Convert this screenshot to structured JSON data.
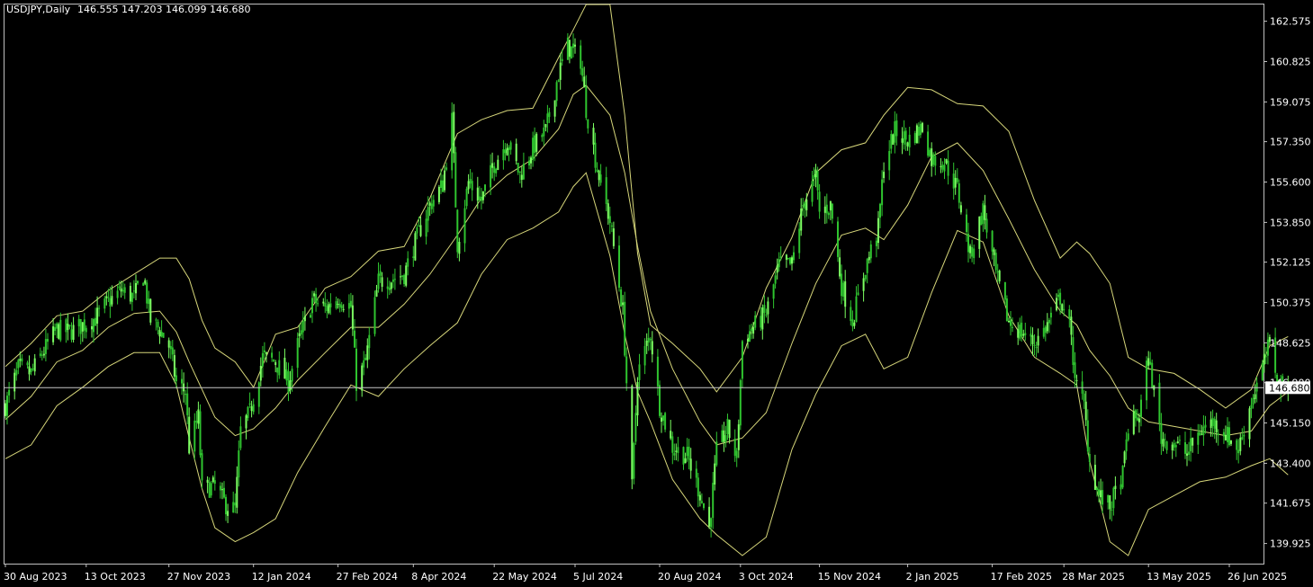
{
  "header": {
    "symbol_label": "USDJPY,Daily",
    "ohlc_text": "146.555 147.203 146.099 146.680"
  },
  "colors": {
    "background": "#000000",
    "frame": "#c0c0c0",
    "candle": "#2fc42f",
    "candle_bright": "#7cff62",
    "bands": "#d6d67a",
    "axis_text": "#ffffff",
    "current_price_line": "#c8c8c8"
  },
  "chart_data": {
    "type": "candlestick",
    "symbol": "USDJPY",
    "timeframe": "Daily",
    "last_ohlc": {
      "open": 146.555,
      "high": 147.203,
      "low": 146.099,
      "close": 146.68
    },
    "current_price": 146.68,
    "current_price_label": "146.680",
    "ylim": [
      139.05,
      163.3
    ],
    "y_ticks": [
      "162.575",
      "160.825",
      "159.075",
      "157.350",
      "155.600",
      "153.850",
      "152.125",
      "150.375",
      "148.625",
      "146.900",
      "145.150",
      "143.400",
      "141.675",
      "139.925"
    ],
    "x_ticks": [
      "30 Aug 2023",
      "13 Oct 2023",
      "27 Nov 2023",
      "12 Jan 2024",
      "27 Feb 2024",
      "8 Apr 2024",
      "22 May 2024",
      "5 Jul 2024",
      "20 Aug 2024",
      "3 Oct 2024",
      "15 Nov 2024",
      "2 Jan 2025",
      "17 Feb 2025",
      "28 Mar 2025",
      "13 May 2025",
      "26 Jun 2025"
    ],
    "indicator": "Bollinger Bands",
    "price_path": [
      [
        "2023-08-30",
        145.9
      ],
      [
        "2023-09-06",
        147.5
      ],
      [
        "2023-09-13",
        147.3
      ],
      [
        "2023-09-20",
        148.3
      ],
      [
        "2023-09-27",
        149.2
      ],
      [
        "2023-10-04",
        149.1
      ],
      [
        "2023-10-11",
        149.4
      ],
      [
        "2023-10-18",
        149.7
      ],
      [
        "2023-10-25",
        150.4
      ],
      [
        "2023-11-01",
        150.9
      ],
      [
        "2023-11-08",
        150.6
      ],
      [
        "2023-11-13",
        151.6
      ],
      [
        "2023-11-17",
        149.6
      ],
      [
        "2023-11-22",
        149.2
      ],
      [
        "2023-11-27",
        148.5
      ],
      [
        "2023-12-01",
        146.9
      ],
      [
        "2023-12-06",
        146.5
      ],
      [
        "2023-12-08",
        144.1
      ],
      [
        "2023-12-13",
        145.4
      ],
      [
        "2023-12-15",
        142.3
      ],
      [
        "2023-12-22",
        142.4
      ],
      [
        "2023-12-28",
        141.6
      ],
      [
        "2024-01-02",
        141.4
      ],
      [
        "2024-01-05",
        144.8
      ],
      [
        "2024-01-10",
        145.6
      ],
      [
        "2024-01-17",
        148.0
      ],
      [
        "2024-01-24",
        147.8
      ],
      [
        "2024-01-31",
        146.9
      ],
      [
        "2024-02-05",
        148.5
      ],
      [
        "2024-02-13",
        150.5
      ],
      [
        "2024-02-20",
        150.1
      ],
      [
        "2024-02-27",
        150.6
      ],
      [
        "2024-03-05",
        150.2
      ],
      [
        "2024-03-08",
        146.9
      ],
      [
        "2024-03-13",
        147.8
      ],
      [
        "2024-03-20",
        151.3
      ],
      [
        "2024-03-27",
        151.4
      ],
      [
        "2024-04-03",
        151.6
      ],
      [
        "2024-04-10",
        153.2
      ],
      [
        "2024-04-17",
        154.6
      ],
      [
        "2024-04-24",
        155.5
      ],
      [
        "2024-04-29",
        158.3
      ],
      [
        "2024-05-02",
        152.9
      ],
      [
        "2024-05-08",
        155.6
      ],
      [
        "2024-05-15",
        154.8
      ],
      [
        "2024-05-22",
        156.4
      ],
      [
        "2024-05-29",
        157.4
      ],
      [
        "2024-06-05",
        155.9
      ],
      [
        "2024-06-12",
        157.1
      ],
      [
        "2024-06-19",
        157.8
      ],
      [
        "2024-06-26",
        160.3
      ],
      [
        "2024-07-01",
        161.5
      ],
      [
        "2024-07-08",
        160.9
      ],
      [
        "2024-07-11",
        158.8
      ],
      [
        "2024-07-17",
        156.2
      ],
      [
        "2024-07-24",
        153.9
      ],
      [
        "2024-07-31",
        150.0
      ],
      [
        "2024-08-05",
        142.3
      ],
      [
        "2024-08-08",
        147.3
      ],
      [
        "2024-08-15",
        149.0
      ],
      [
        "2024-08-20",
        145.9
      ],
      [
        "2024-08-27",
        144.1
      ],
      [
        "2024-09-04",
        143.7
      ],
      [
        "2024-09-11",
        142.1
      ],
      [
        "2024-09-16",
        140.6
      ],
      [
        "2024-09-20",
        143.9
      ],
      [
        "2024-09-26",
        144.9
      ],
      [
        "2024-10-01",
        143.6
      ],
      [
        "2024-10-04",
        148.7
      ],
      [
        "2024-10-10",
        149.3
      ],
      [
        "2024-10-17",
        149.9
      ],
      [
        "2024-10-24",
        152.0
      ],
      [
        "2024-10-31",
        152.0
      ],
      [
        "2024-11-06",
        154.6
      ],
      [
        "2024-11-13",
        155.8
      ],
      [
        "2024-11-15",
        154.3
      ],
      [
        "2024-11-21",
        154.6
      ],
      [
        "2024-11-27",
        151.1
      ],
      [
        "2024-12-03",
        149.6
      ],
      [
        "2024-12-10",
        151.9
      ],
      [
        "2024-12-17",
        153.6
      ],
      [
        "2024-12-20",
        156.4
      ],
      [
        "2024-12-26",
        157.8
      ],
      [
        "2025-01-02",
        157.4
      ],
      [
        "2025-01-10",
        158.0
      ],
      [
        "2025-01-15",
        156.6
      ],
      [
        "2025-01-22",
        156.5
      ],
      [
        "2025-01-29",
        155.3
      ],
      [
        "2025-02-05",
        152.4
      ],
      [
        "2025-02-12",
        154.4
      ],
      [
        "2025-02-19",
        151.6
      ],
      [
        "2025-02-26",
        149.5
      ],
      [
        "2025-03-05",
        149.1
      ],
      [
        "2025-03-12",
        148.6
      ],
      [
        "2025-03-19",
        149.4
      ],
      [
        "2025-03-26",
        150.6
      ],
      [
        "2025-03-31",
        149.3
      ],
      [
        "2025-04-04",
        146.7
      ],
      [
        "2025-04-08",
        145.9
      ],
      [
        "2025-04-11",
        143.5
      ],
      [
        "2025-04-16",
        142.0
      ],
      [
        "2025-04-22",
        141.5
      ],
      [
        "2025-04-29",
        142.9
      ],
      [
        "2025-05-02",
        145.0
      ],
      [
        "2025-05-08",
        145.5
      ],
      [
        "2025-05-13",
        148.0
      ],
      [
        "2025-05-20",
        144.5
      ],
      [
        "2025-05-27",
        144.3
      ],
      [
        "2025-06-03",
        143.8
      ],
      [
        "2025-06-10",
        144.8
      ],
      [
        "2025-06-17",
        145.2
      ],
      [
        "2025-06-24",
        144.7
      ],
      [
        "2025-07-01",
        144.0
      ],
      [
        "2025-07-08",
        146.1
      ],
      [
        "2025-07-15",
        147.8
      ],
      [
        "2025-07-18",
        148.6
      ],
      [
        "2025-07-23",
        146.8
      ],
      [
        "2025-07-28",
        146.68
      ]
    ],
    "upper_band": [
      [
        "2023-08-30",
        147.6
      ],
      [
        "2023-09-13",
        148.6
      ],
      [
        "2023-09-27",
        149.8
      ],
      [
        "2023-10-11",
        150.0
      ],
      [
        "2023-10-25",
        150.9
      ],
      [
        "2023-11-08",
        151.6
      ],
      [
        "2023-11-22",
        152.3
      ],
      [
        "2023-12-01",
        152.3
      ],
      [
        "2023-12-08",
        151.4
      ],
      [
        "2023-12-15",
        149.6
      ],
      [
        "2023-12-22",
        148.4
      ],
      [
        "2024-01-02",
        147.8
      ],
      [
        "2024-01-12",
        146.7
      ],
      [
        "2024-01-24",
        149.0
      ],
      [
        "2024-02-05",
        149.3
      ],
      [
        "2024-02-20",
        151.0
      ],
      [
        "2024-03-05",
        151.5
      ],
      [
        "2024-03-20",
        152.6
      ],
      [
        "2024-04-03",
        152.8
      ],
      [
        "2024-04-17",
        154.9
      ],
      [
        "2024-05-02",
        157.7
      ],
      [
        "2024-05-15",
        158.3
      ],
      [
        "2024-05-29",
        158.7
      ],
      [
        "2024-06-12",
        158.8
      ],
      [
        "2024-06-26",
        161.0
      ],
      [
        "2024-07-04",
        162.2
      ],
      [
        "2024-07-11",
        163.3
      ],
      [
        "2024-07-24",
        163.3
      ],
      [
        "2024-08-01",
        158.5
      ],
      [
        "2024-08-08",
        152.5
      ],
      [
        "2024-08-15",
        149.4
      ],
      [
        "2024-08-27",
        148.6
      ],
      [
        "2024-09-11",
        147.5
      ],
      [
        "2024-09-20",
        146.5
      ],
      [
        "2024-10-04",
        148.0
      ],
      [
        "2024-10-17",
        151.0
      ],
      [
        "2024-10-31",
        153.2
      ],
      [
        "2024-11-13",
        156.0
      ],
      [
        "2024-11-27",
        157.0
      ],
      [
        "2024-12-10",
        157.3
      ],
      [
        "2024-12-20",
        158.5
      ],
      [
        "2025-01-02",
        159.7
      ],
      [
        "2025-01-15",
        159.6
      ],
      [
        "2025-01-29",
        159.0
      ],
      [
        "2025-02-12",
        158.9
      ],
      [
        "2025-02-26",
        157.8
      ],
      [
        "2025-03-12",
        154.8
      ],
      [
        "2025-03-26",
        152.3
      ],
      [
        "2025-04-04",
        153.0
      ],
      [
        "2025-04-11",
        152.5
      ],
      [
        "2025-04-22",
        151.2
      ],
      [
        "2025-05-02",
        148.0
      ],
      [
        "2025-05-13",
        147.5
      ],
      [
        "2025-05-27",
        147.3
      ],
      [
        "2025-06-10",
        146.6
      ],
      [
        "2025-06-24",
        145.8
      ],
      [
        "2025-07-08",
        146.6
      ],
      [
        "2025-07-18",
        148.5
      ],
      [
        "2025-07-28",
        148.9
      ]
    ],
    "middle_band": [
      [
        "2023-08-30",
        145.3
      ],
      [
        "2023-09-13",
        146.3
      ],
      [
        "2023-09-27",
        147.8
      ],
      [
        "2023-10-11",
        148.3
      ],
      [
        "2023-10-25",
        149.3
      ],
      [
        "2023-11-08",
        149.9
      ],
      [
        "2023-11-22",
        150.0
      ],
      [
        "2023-12-01",
        149.1
      ],
      [
        "2023-12-08",
        147.8
      ],
      [
        "2023-12-15",
        146.6
      ],
      [
        "2023-12-22",
        145.4
      ],
      [
        "2024-01-02",
        144.6
      ],
      [
        "2024-01-12",
        144.9
      ],
      [
        "2024-01-24",
        145.8
      ],
      [
        "2024-02-05",
        147.0
      ],
      [
        "2024-02-20",
        148.2
      ],
      [
        "2024-03-05",
        149.3
      ],
      [
        "2024-03-20",
        149.3
      ],
      [
        "2024-04-03",
        150.3
      ],
      [
        "2024-04-17",
        151.6
      ],
      [
        "2024-05-02",
        153.3
      ],
      [
        "2024-05-15",
        154.9
      ],
      [
        "2024-05-29",
        155.9
      ],
      [
        "2024-06-12",
        156.6
      ],
      [
        "2024-06-26",
        157.9
      ],
      [
        "2024-07-04",
        159.4
      ],
      [
        "2024-07-11",
        159.8
      ],
      [
        "2024-07-24",
        158.5
      ],
      [
        "2024-08-01",
        156.0
      ],
      [
        "2024-08-08",
        152.8
      ],
      [
        "2024-08-15",
        150.0
      ],
      [
        "2024-08-27",
        147.5
      ],
      [
        "2024-09-11",
        145.2
      ],
      [
        "2024-09-20",
        144.2
      ],
      [
        "2024-10-04",
        144.5
      ],
      [
        "2024-10-17",
        145.6
      ],
      [
        "2024-10-31",
        148.6
      ],
      [
        "2024-11-13",
        151.2
      ],
      [
        "2024-11-27",
        153.3
      ],
      [
        "2024-12-10",
        153.6
      ],
      [
        "2024-12-20",
        153.1
      ],
      [
        "2025-01-02",
        154.6
      ],
      [
        "2025-01-15",
        156.7
      ],
      [
        "2025-01-29",
        157.3
      ],
      [
        "2025-02-12",
        156.1
      ],
      [
        "2025-02-26",
        154.0
      ],
      [
        "2025-03-12",
        151.8
      ],
      [
        "2025-03-26",
        150.0
      ],
      [
        "2025-04-04",
        149.4
      ],
      [
        "2025-04-11",
        148.3
      ],
      [
        "2025-04-22",
        147.2
      ],
      [
        "2025-05-02",
        145.8
      ],
      [
        "2025-05-13",
        145.2
      ],
      [
        "2025-05-27",
        145.0
      ],
      [
        "2025-06-10",
        144.8
      ],
      [
        "2025-06-24",
        144.6
      ],
      [
        "2025-07-08",
        144.8
      ],
      [
        "2025-07-18",
        145.9
      ],
      [
        "2025-07-28",
        146.5
      ]
    ],
    "lower_band": [
      [
        "2023-08-30",
        143.6
      ],
      [
        "2023-09-13",
        144.2
      ],
      [
        "2023-09-27",
        145.9
      ],
      [
        "2023-10-11",
        146.7
      ],
      [
        "2023-10-25",
        147.6
      ],
      [
        "2023-11-08",
        148.2
      ],
      [
        "2023-11-22",
        148.2
      ],
      [
        "2023-12-01",
        146.8
      ],
      [
        "2023-12-08",
        144.5
      ],
      [
        "2023-12-15",
        142.3
      ],
      [
        "2023-12-22",
        140.6
      ],
      [
        "2024-01-02",
        140.0
      ],
      [
        "2024-01-12",
        140.4
      ],
      [
        "2024-01-24",
        141.0
      ],
      [
        "2024-02-05",
        143.0
      ],
      [
        "2024-02-20",
        145.0
      ],
      [
        "2024-03-05",
        146.8
      ],
      [
        "2024-03-20",
        146.3
      ],
      [
        "2024-04-03",
        147.5
      ],
      [
        "2024-04-17",
        148.5
      ],
      [
        "2024-05-02",
        149.5
      ],
      [
        "2024-05-15",
        151.6
      ],
      [
        "2024-05-29",
        153.1
      ],
      [
        "2024-06-12",
        153.6
      ],
      [
        "2024-06-26",
        154.3
      ],
      [
        "2024-07-04",
        155.4
      ],
      [
        "2024-07-11",
        156.0
      ],
      [
        "2024-07-24",
        152.4
      ],
      [
        "2024-08-01",
        149.0
      ],
      [
        "2024-08-08",
        146.5
      ],
      [
        "2024-08-15",
        145.2
      ],
      [
        "2024-08-27",
        142.7
      ],
      [
        "2024-09-11",
        141.0
      ],
      [
        "2024-09-20",
        140.3
      ],
      [
        "2024-10-04",
        139.4
      ],
      [
        "2024-10-17",
        140.2
      ],
      [
        "2024-10-31",
        144.0
      ],
      [
        "2024-11-13",
        146.4
      ],
      [
        "2024-11-27",
        148.5
      ],
      [
        "2024-12-10",
        149.0
      ],
      [
        "2024-12-20",
        147.5
      ],
      [
        "2025-01-02",
        148.0
      ],
      [
        "2025-01-15",
        150.8
      ],
      [
        "2025-01-29",
        153.5
      ],
      [
        "2025-02-12",
        153.0
      ],
      [
        "2025-02-26",
        149.8
      ],
      [
        "2025-03-12",
        148.0
      ],
      [
        "2025-03-26",
        147.3
      ],
      [
        "2025-04-04",
        146.8
      ],
      [
        "2025-04-11",
        143.5
      ],
      [
        "2025-04-22",
        140.0
      ],
      [
        "2025-05-02",
        139.4
      ],
      [
        "2025-05-13",
        141.4
      ],
      [
        "2025-05-27",
        142.0
      ],
      [
        "2025-06-10",
        142.6
      ],
      [
        "2025-06-24",
        142.8
      ],
      [
        "2025-07-08",
        143.3
      ],
      [
        "2025-07-18",
        143.6
      ],
      [
        "2025-07-28",
        142.9
      ]
    ]
  }
}
